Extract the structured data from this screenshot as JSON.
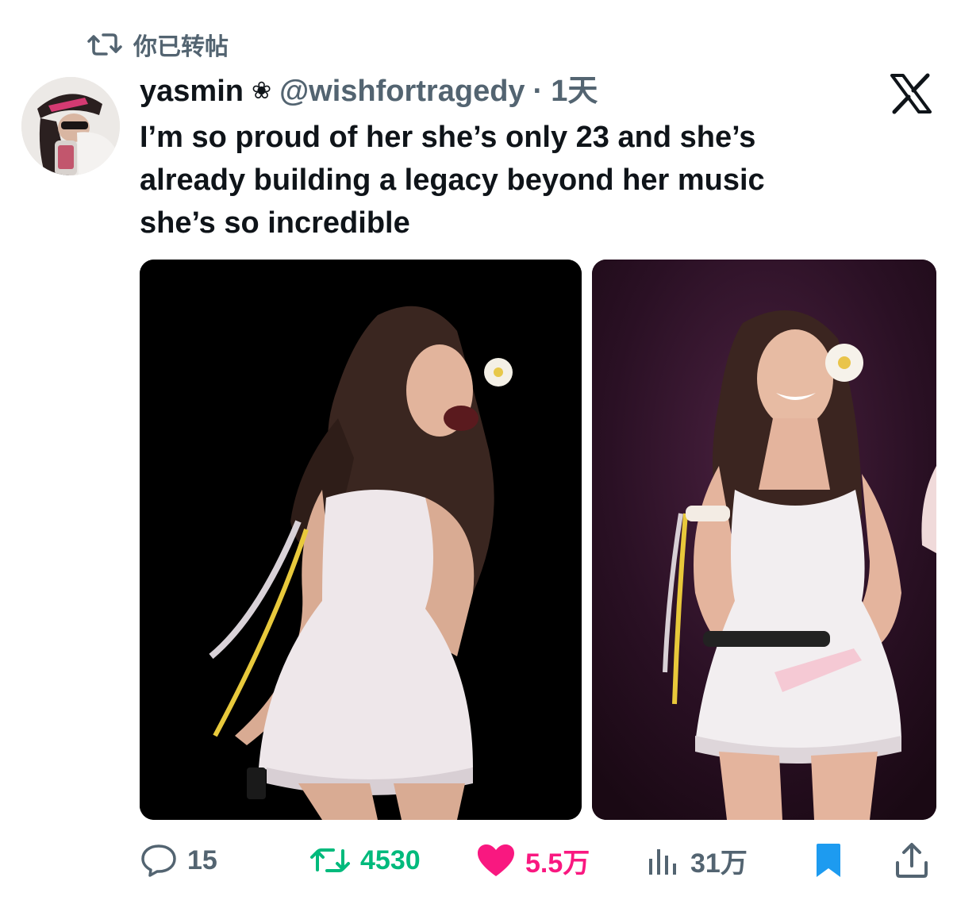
{
  "retweet_banner": {
    "label": "你已转帖",
    "icon": "repost-icon"
  },
  "tweet": {
    "author": {
      "display_name": "yasmin",
      "name_icon": "❀",
      "handle": "@wishfortragedy",
      "separator": "·",
      "time": "1天",
      "avatar_icon": "avatar"
    },
    "platform_logo": "x-logo-icon",
    "text_lines": [
      "I’m so proud of her she’s only 23 and she’s",
      "already building a legacy beyond her music",
      "she’s so incredible"
    ],
    "media": [
      {
        "name": "photo-1",
        "background": "#000000"
      },
      {
        "name": "photo-2",
        "background": "#26101f"
      }
    ]
  },
  "actions": {
    "replies": "15",
    "reposts": "4530",
    "likes": "5.5万",
    "views": "31万",
    "reply_icon": "reply-icon",
    "repost_icon": "repost-icon",
    "like_icon": "heart-icon",
    "views_icon": "views-icon",
    "bookmark_icon": "bookmark-icon",
    "share_icon": "share-icon"
  },
  "colors": {
    "text_primary": "#0f1419",
    "text_secondary": "#536471",
    "repost_active": "#00ba7c",
    "like_active": "#f91880",
    "bookmark_active": "#1d9bf0"
  }
}
